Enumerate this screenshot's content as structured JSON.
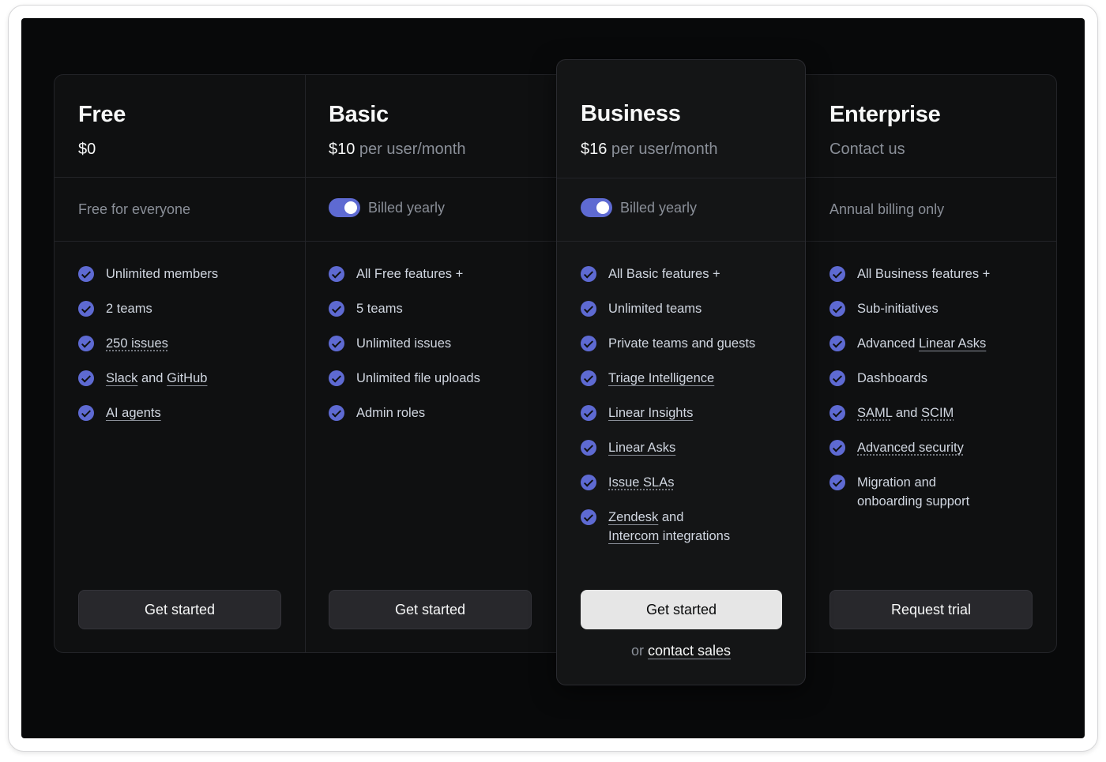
{
  "plans": {
    "free": {
      "name": "Free",
      "price": "$0",
      "billing": "Free for everyone",
      "features": {
        "f1": "Unlimited members",
        "f2": "2 teams",
        "f3": "250 issues",
        "f4_a": "Slack",
        "f4_b": " and ",
        "f4_c": "GitHub",
        "f5": "AI agents"
      },
      "cta": "Get started"
    },
    "basic": {
      "name": "Basic",
      "price": "$10",
      "price_unit": " per user/month",
      "billing": "Billed yearly",
      "features": {
        "f1": "All Free features +",
        "f2": "5 teams",
        "f3": "Unlimited issues",
        "f4": "Unlimited file uploads",
        "f5": "Admin roles"
      },
      "cta": "Get started"
    },
    "business": {
      "name": "Business",
      "price": "$16",
      "price_unit": " per user/month",
      "billing": "Billed yearly",
      "features": {
        "f1": "All Basic features +",
        "f2": "Unlimited teams",
        "f3": "Private teams and guests",
        "f4": "Triage Intelligence",
        "f5": "Linear Insights",
        "f6": "Linear Asks",
        "f7": "Issue SLAs",
        "f8_a": "Zendesk",
        "f8_b": " and ",
        "f8_c": "Intercom",
        "f8_d": " integrations"
      },
      "cta": "Get started",
      "or_text": "or ",
      "contact_sales": "contact sales"
    },
    "enterprise": {
      "name": "Enterprise",
      "price": "Contact us",
      "billing": "Annual billing only",
      "features": {
        "f1": "All Business features +",
        "f2": "Sub-initiatives",
        "f3_a": "Advanced ",
        "f3_b": "Linear Asks",
        "f4": "Dashboards",
        "f5_a": "SAML",
        "f5_b": " and ",
        "f5_c": "SCIM",
        "f6": "Advanced security",
        "f7": "Migration and onboarding support"
      },
      "cta": "Request trial"
    }
  },
  "colors": {
    "background": "#08090a",
    "accent": "#5e6ad2",
    "text_primary": "#f7f8f8",
    "text_secondary": "#8a8f98"
  },
  "icons": {
    "feature": "check-circle-icon",
    "toggle": "toggle-switch"
  }
}
